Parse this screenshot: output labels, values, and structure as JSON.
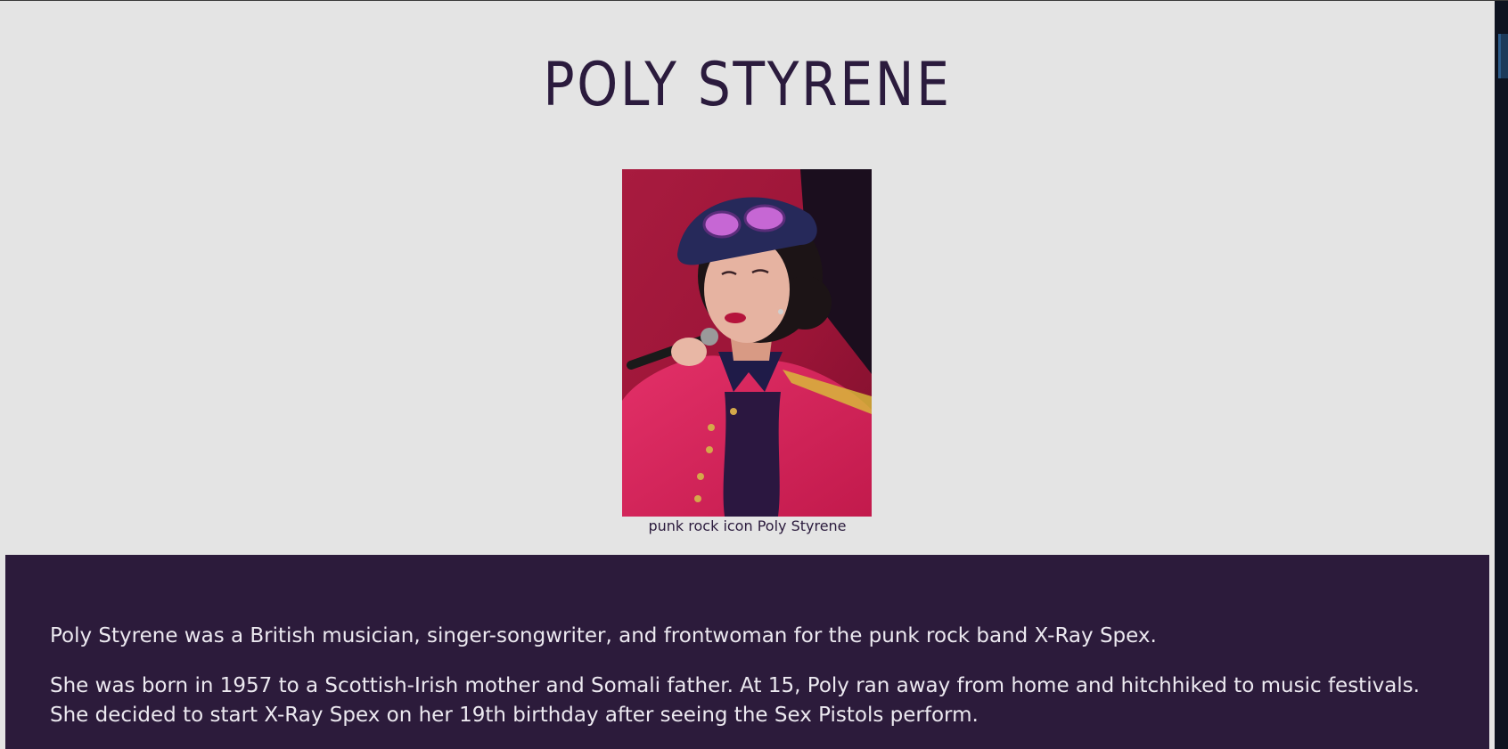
{
  "title": "POLY STYRENE",
  "image": {
    "alt": "Poly Styrene",
    "caption": "punk rock icon Poly Styrene"
  },
  "bio": {
    "paragraphs": [
      "Poly Styrene was a British musician, singer-songwriter, and frontwoman for the punk rock band X-Ray Spex.",
      "She was born in 1957 to a Scottish-Irish mother and Somali father. At 15, Poly ran away from home and hitchhiked to music festivals. She decided to start X-Ray Spex on her 19th birthday after seeing the Sex Pistols perform."
    ]
  },
  "colors": {
    "page_background": "#e4e4e4",
    "title_text": "#2b1b3d",
    "bio_background": "#2c1b3b",
    "bio_text": "#ece9f0"
  }
}
